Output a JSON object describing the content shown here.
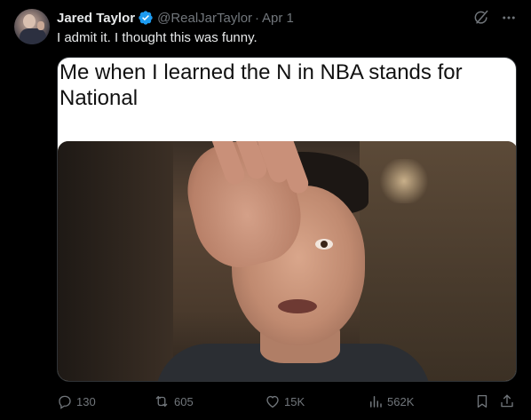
{
  "author": {
    "name": "Jared Taylor",
    "handle": "@RealJarTaylor",
    "separator": "·",
    "date": "Apr 1",
    "verified": true,
    "verified_color": "#1d9bf0"
  },
  "post": {
    "text": "I admit it. I thought this was funny.",
    "image_caption": "Me when I learned the N in NBA stands for National"
  },
  "actions": {
    "replies": "130",
    "reposts": "605",
    "likes": "15K",
    "views": "562K"
  },
  "icons": {
    "grok": "grok-icon",
    "more": "more-icon",
    "reply": "reply-icon",
    "repost": "repost-icon",
    "like": "heart-icon",
    "views": "views-icon",
    "bookmark": "bookmark-icon",
    "share": "share-icon"
  },
  "colors": {
    "background": "#000000",
    "text": "#e7e9ea",
    "muted": "#71767b",
    "accent": "#1d9bf0"
  }
}
